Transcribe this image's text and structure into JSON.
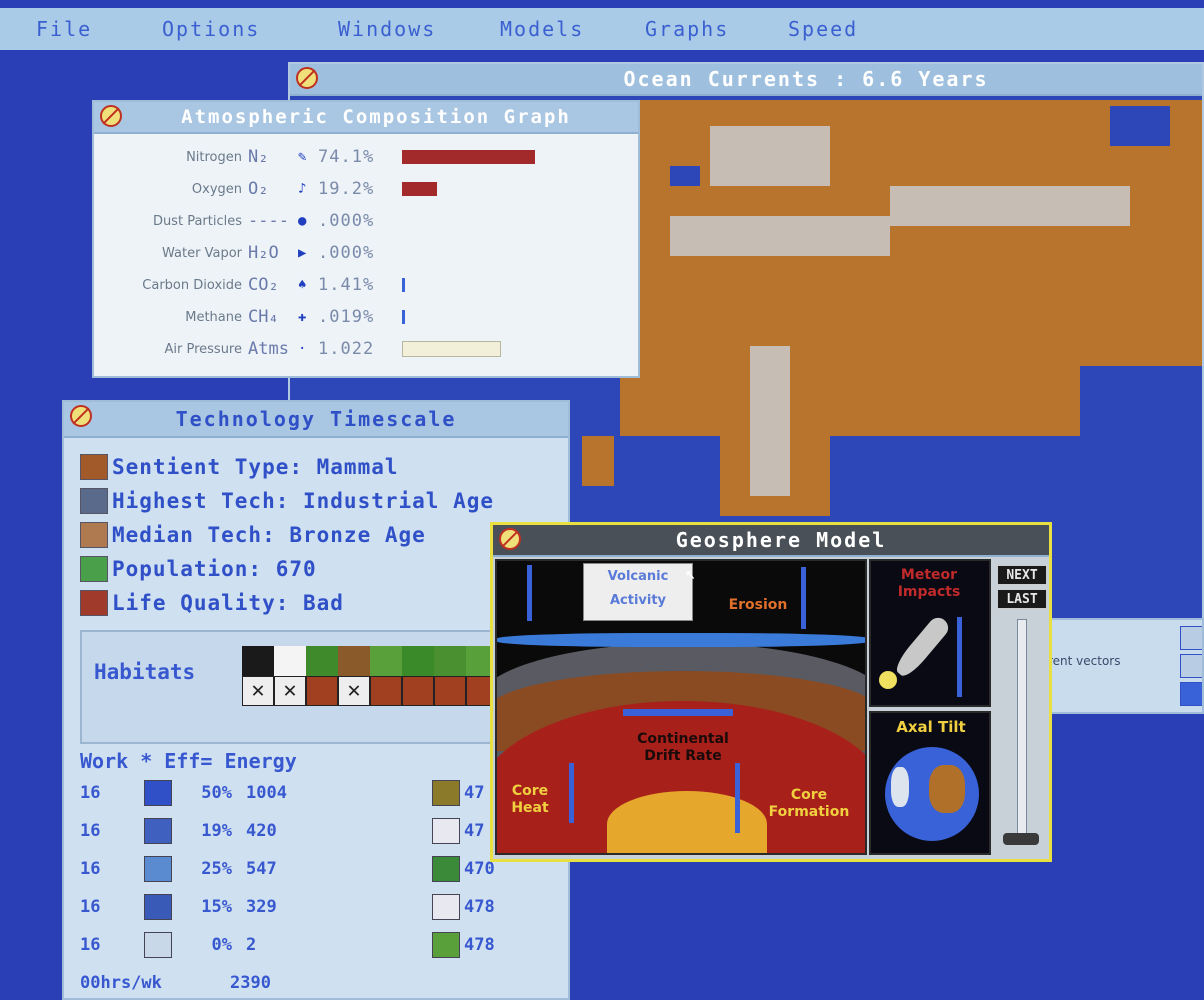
{
  "menu": [
    "File",
    "Options",
    "Windows",
    "Models",
    "Graphs",
    "Speed"
  ],
  "ocean": {
    "title": "Ocean Currents : 6.6 Years"
  },
  "atmosphere": {
    "title": "Atmospheric Composition Graph",
    "rows": [
      {
        "name": "Nitrogen",
        "formula": "N₂",
        "value": "74.1%",
        "level": 0.741,
        "color": "#a32a2a"
      },
      {
        "name": "Oxygen",
        "formula": "O₂",
        "value": "19.2%",
        "level": 0.192,
        "color": "#a32a2a"
      },
      {
        "name": "Dust Particles",
        "formula": "----",
        "value": ".000%",
        "level": 0,
        "color": "#a32a2a"
      },
      {
        "name": "Water Vapor",
        "formula": "H₂O",
        "value": ".000%",
        "level": 0,
        "color": "#a32a2a"
      },
      {
        "name": "Carbon Dioxide",
        "formula": "CO₂",
        "value": "1.41%",
        "level": 0.0141,
        "color": "#3a62d8"
      },
      {
        "name": "Methane",
        "formula": "CH₄",
        "value": ".019%",
        "level": 0.00019,
        "color": "#3a62d8"
      },
      {
        "name": "Air Pressure",
        "formula": "Atms",
        "value": "1.022",
        "level": 1.022,
        "color": "#f2f0d8"
      }
    ]
  },
  "tech": {
    "title": "Technology Timescale",
    "lines": [
      "Sentient Type: Mammal",
      "Highest Tech: Industrial Age",
      "Median Tech: Bronze Age",
      "Population: 670",
      "Life Quality: Bad"
    ],
    "habitats_label": "Habitats",
    "energy_header": "Work * Eff= Energy",
    "energy_rows": [
      {
        "work": "16",
        "eff": "50%",
        "energy": "1004"
      },
      {
        "work": "16",
        "eff": "19%",
        "energy": "420"
      },
      {
        "work": "16",
        "eff": "25%",
        "energy": "547"
      },
      {
        "work": "16",
        "eff": "15%",
        "energy": "329"
      },
      {
        "work": "16",
        "eff": "0%",
        "energy": "2"
      }
    ],
    "right_values": [
      "47",
      "47",
      "470",
      "478",
      "478"
    ],
    "footer_left": "00hrs/wk",
    "footer_right": "2390"
  },
  "geosphere": {
    "title": "Geosphere Model",
    "volcanic": "Volcanic Activity",
    "erosion": "Erosion",
    "meteor": "Meteor Impacts",
    "axial": "Axal Tilt",
    "drift": "Continental Drift Rate",
    "core_heat": "Core Heat",
    "core_formation": "Core Formation",
    "next": "NEXT",
    "last": "LAST"
  },
  "vectors": {
    "label": "rent vectors"
  },
  "colors": {
    "ocean": "#2d46b8",
    "land": "#b8742c",
    "accent": "#3050c8"
  }
}
